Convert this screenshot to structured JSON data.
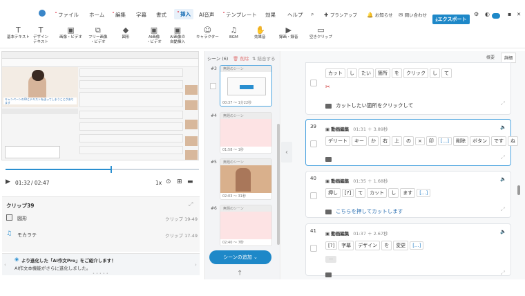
{
  "menu": {
    "items": [
      "ファイル",
      "ホーム",
      "編集",
      "字幕",
      "書式",
      "挿入",
      "AI音声",
      "テンプレート",
      "効果",
      "ヘルプ"
    ],
    "active": "挿入",
    "right": {
      "upgrade": "プランアップ",
      "notice": "お知らせ",
      "contact": "問い合わせ",
      "export": "エクスポート"
    }
  },
  "toolbar": {
    "tools": [
      {
        "l1": "基本テキスト",
        "l2": "",
        "icon": "text-icon"
      },
      {
        "l1": "デザイン",
        "l2": "テキスト",
        "icon": "design-text-icon"
      },
      {
        "l1": "画像・ビデオ",
        "l2": "",
        "icon": "image-icon"
      },
      {
        "l1": "フリー画像",
        "l2": "・ビデオ",
        "icon": "free-image-icon"
      },
      {
        "l1": "図形",
        "l2": "",
        "icon": "shape-icon"
      },
      {
        "l1": "AI画像",
        "l2": "・ビデオ",
        "icon": "ai-image-icon"
      },
      {
        "l1": "AI画像の",
        "l2": "自動挿入",
        "icon": "ai-auto-icon"
      },
      {
        "l1": "キャラクター",
        "l2": "",
        "icon": "character-icon"
      },
      {
        "l1": "BGM",
        "l2": "",
        "icon": "music-icon"
      },
      {
        "l1": "効果音",
        "l2": "",
        "icon": "sound-effect-icon"
      },
      {
        "l1": "録画・録音",
        "l2": "",
        "icon": "record-icon"
      },
      {
        "l1": "空きクリップ",
        "l2": "",
        "icon": "empty-clip-icon"
      }
    ]
  },
  "player": {
    "current": "01:32",
    "total": "/ 02:47",
    "speed": "1x",
    "progress": 0.55,
    "inner_caption": "キャンペーンのIDとテキストを送ってしまうことがあります"
  },
  "clip_panel": {
    "title": "クリップ39",
    "rows": [
      {
        "label": "図形",
        "range": "クリップ 19-49"
      },
      {
        "label": "モカラテ",
        "range": "クリップ 17-49"
      }
    ]
  },
  "notice": {
    "title": "より進化した「AI作文Pro」をご紹介します！",
    "body": "AI作文本機能がさらに進化しました。"
  },
  "scenes": {
    "header": "シーン (6)",
    "delete": "削除",
    "merge": "結合する",
    "add_label": "シーンの追加",
    "items": [
      {
        "num": "#3",
        "label": "無題のシーン",
        "time": "00:37 ～ 1分22秒",
        "bg": "#ffffff"
      },
      {
        "num": "#4",
        "label": "無題のシーン",
        "time": "01:58 ～ 1秒",
        "bg": "#fde3e4"
      },
      {
        "num": "#5",
        "label": "無題のシーン",
        "time": "02:03 ～ 31秒",
        "bg": "#d9b08c"
      },
      {
        "num": "#6",
        "label": "無題のシーン",
        "time": "02:40 ～ 7秒",
        "bg": "#fde3e4"
      }
    ]
  },
  "right_tabs": {
    "overview": "概要",
    "detail": "詳細"
  },
  "clips": [
    {
      "num": "",
      "title": "",
      "time": "",
      "tokens": [
        "カット",
        "し",
        "たい",
        "箇所",
        "を",
        "クリック",
        "し",
        "て"
      ],
      "caption": "カットしたい箇所をクリックして",
      "selected": false
    },
    {
      "num": "39",
      "title": "動画編集",
      "time": "01:31 ＋ 3.89秒",
      "tokens": [
        "デリート",
        "キー",
        "か",
        "右",
        "上",
        "の",
        "×",
        "印",
        "[...]",
        "削除",
        "ボタン",
        "です",
        "ね"
      ],
      "caption": "",
      "selected": true
    },
    {
      "num": "40",
      "title": "動画編集",
      "time": "01:35 ＋ 1.68秒",
      "tokens": [
        "押し",
        "[?]",
        "て",
        "カット",
        "し",
        "ます",
        "[...]"
      ],
      "caption": "こちらを押してカットします",
      "selected": false
    },
    {
      "num": "41",
      "title": "動画編集",
      "time": "01:37 ＋ 2.67秒",
      "tokens": [
        "[?]",
        "字幕",
        "デザイン",
        "を",
        "変更",
        "[...]"
      ],
      "caption": "",
      "selected": false
    }
  ],
  "colors": {
    "accent": "#1e88c8",
    "selected_border": "#4aa3df",
    "danger": "#e0384b"
  }
}
